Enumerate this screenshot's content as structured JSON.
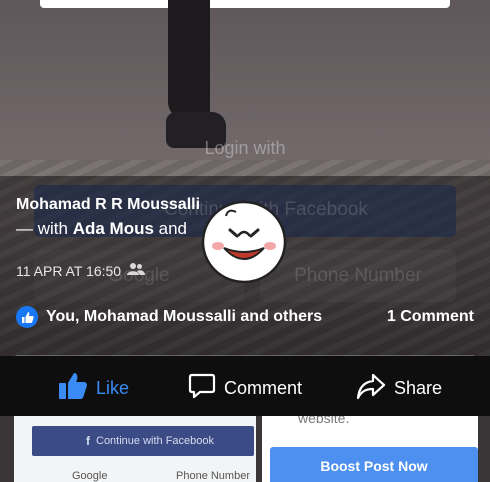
{
  "background": {
    "login_with": "Login with",
    "continue_fb": "Continue with Facebook",
    "google": "Google",
    "phone_number": "Phone Number"
  },
  "post": {
    "author": "Mohamad R R Moussalli",
    "with_prefix": "— with ",
    "with_name": "Ada Mous",
    "with_suffix": " and",
    "timestamp": "11 APR AT 16:50",
    "audience_icon": "friends-icon",
    "sticker_icon": "happy-face-sticker",
    "reactions_text": "You, Mohamad Moussalli and others",
    "comments_count": "1 Comment"
  },
  "actions": {
    "like": "Like",
    "comment": "Comment",
    "share": "Share",
    "like_color": "#3b8bf5"
  },
  "bottom": {
    "continue_fb": "Continue with Facebook",
    "google": "Google",
    "phone_number": "Phone Number",
    "website": "website.",
    "boost": "Boost Post Now",
    "boost_color": "#4e90f0"
  }
}
